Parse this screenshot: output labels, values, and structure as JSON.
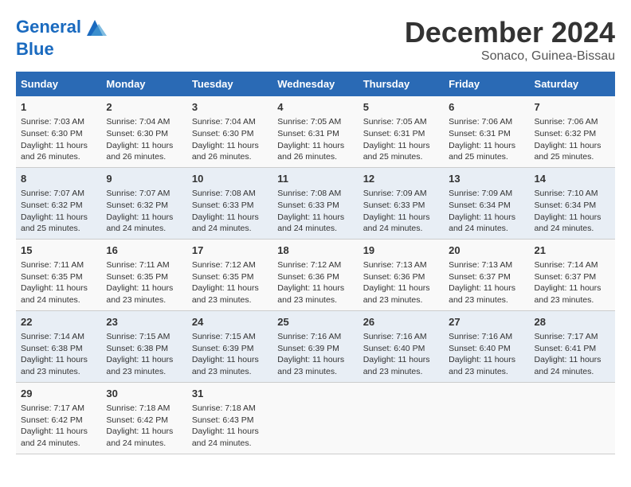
{
  "header": {
    "logo_line1": "General",
    "logo_line2": "Blue",
    "month_title": "December 2024",
    "location": "Sonaco, Guinea-Bissau"
  },
  "weekdays": [
    "Sunday",
    "Monday",
    "Tuesday",
    "Wednesday",
    "Thursday",
    "Friday",
    "Saturday"
  ],
  "weeks": [
    [
      {
        "day": "1",
        "sunrise": "7:03 AM",
        "sunset": "6:30 PM",
        "daylight": "11 hours and 26 minutes."
      },
      {
        "day": "2",
        "sunrise": "7:04 AM",
        "sunset": "6:30 PM",
        "daylight": "11 hours and 26 minutes."
      },
      {
        "day": "3",
        "sunrise": "7:04 AM",
        "sunset": "6:30 PM",
        "daylight": "11 hours and 26 minutes."
      },
      {
        "day": "4",
        "sunrise": "7:05 AM",
        "sunset": "6:31 PM",
        "daylight": "11 hours and 26 minutes."
      },
      {
        "day": "5",
        "sunrise": "7:05 AM",
        "sunset": "6:31 PM",
        "daylight": "11 hours and 25 minutes."
      },
      {
        "day": "6",
        "sunrise": "7:06 AM",
        "sunset": "6:31 PM",
        "daylight": "11 hours and 25 minutes."
      },
      {
        "day": "7",
        "sunrise": "7:06 AM",
        "sunset": "6:32 PM",
        "daylight": "11 hours and 25 minutes."
      }
    ],
    [
      {
        "day": "8",
        "sunrise": "7:07 AM",
        "sunset": "6:32 PM",
        "daylight": "11 hours and 25 minutes."
      },
      {
        "day": "9",
        "sunrise": "7:07 AM",
        "sunset": "6:32 PM",
        "daylight": "11 hours and 24 minutes."
      },
      {
        "day": "10",
        "sunrise": "7:08 AM",
        "sunset": "6:33 PM",
        "daylight": "11 hours and 24 minutes."
      },
      {
        "day": "11",
        "sunrise": "7:08 AM",
        "sunset": "6:33 PM",
        "daylight": "11 hours and 24 minutes."
      },
      {
        "day": "12",
        "sunrise": "7:09 AM",
        "sunset": "6:33 PM",
        "daylight": "11 hours and 24 minutes."
      },
      {
        "day": "13",
        "sunrise": "7:09 AM",
        "sunset": "6:34 PM",
        "daylight": "11 hours and 24 minutes."
      },
      {
        "day": "14",
        "sunrise": "7:10 AM",
        "sunset": "6:34 PM",
        "daylight": "11 hours and 24 minutes."
      }
    ],
    [
      {
        "day": "15",
        "sunrise": "7:11 AM",
        "sunset": "6:35 PM",
        "daylight": "11 hours and 24 minutes."
      },
      {
        "day": "16",
        "sunrise": "7:11 AM",
        "sunset": "6:35 PM",
        "daylight": "11 hours and 23 minutes."
      },
      {
        "day": "17",
        "sunrise": "7:12 AM",
        "sunset": "6:35 PM",
        "daylight": "11 hours and 23 minutes."
      },
      {
        "day": "18",
        "sunrise": "7:12 AM",
        "sunset": "6:36 PM",
        "daylight": "11 hours and 23 minutes."
      },
      {
        "day": "19",
        "sunrise": "7:13 AM",
        "sunset": "6:36 PM",
        "daylight": "11 hours and 23 minutes."
      },
      {
        "day": "20",
        "sunrise": "7:13 AM",
        "sunset": "6:37 PM",
        "daylight": "11 hours and 23 minutes."
      },
      {
        "day": "21",
        "sunrise": "7:14 AM",
        "sunset": "6:37 PM",
        "daylight": "11 hours and 23 minutes."
      }
    ],
    [
      {
        "day": "22",
        "sunrise": "7:14 AM",
        "sunset": "6:38 PM",
        "daylight": "11 hours and 23 minutes."
      },
      {
        "day": "23",
        "sunrise": "7:15 AM",
        "sunset": "6:38 PM",
        "daylight": "11 hours and 23 minutes."
      },
      {
        "day": "24",
        "sunrise": "7:15 AM",
        "sunset": "6:39 PM",
        "daylight": "11 hours and 23 minutes."
      },
      {
        "day": "25",
        "sunrise": "7:16 AM",
        "sunset": "6:39 PM",
        "daylight": "11 hours and 23 minutes."
      },
      {
        "day": "26",
        "sunrise": "7:16 AM",
        "sunset": "6:40 PM",
        "daylight": "11 hours and 23 minutes."
      },
      {
        "day": "27",
        "sunrise": "7:16 AM",
        "sunset": "6:40 PM",
        "daylight": "11 hours and 23 minutes."
      },
      {
        "day": "28",
        "sunrise": "7:17 AM",
        "sunset": "6:41 PM",
        "daylight": "11 hours and 24 minutes."
      }
    ],
    [
      {
        "day": "29",
        "sunrise": "7:17 AM",
        "sunset": "6:42 PM",
        "daylight": "11 hours and 24 minutes."
      },
      {
        "day": "30",
        "sunrise": "7:18 AM",
        "sunset": "6:42 PM",
        "daylight": "11 hours and 24 minutes."
      },
      {
        "day": "31",
        "sunrise": "7:18 AM",
        "sunset": "6:43 PM",
        "daylight": "11 hours and 24 minutes."
      },
      null,
      null,
      null,
      null
    ]
  ]
}
